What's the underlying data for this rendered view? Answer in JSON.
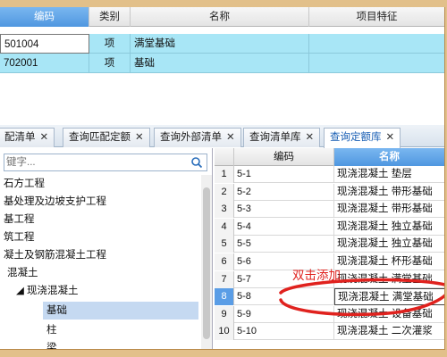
{
  "top_table": {
    "headers": {
      "code": "编码",
      "category": "类别",
      "name": "名称",
      "feature": "项目特征"
    },
    "rows": [
      {
        "code": "501004",
        "category": "项",
        "name": "满堂基础"
      },
      {
        "code": "702001",
        "category": "项",
        "name": "基础"
      }
    ]
  },
  "tabs": [
    {
      "label": "配清单",
      "close": "✕"
    },
    {
      "label": "查询匹配定额",
      "close": "✕"
    },
    {
      "label": "查询外部清单",
      "close": "✕"
    },
    {
      "label": "查询清单库",
      "close": "✕"
    },
    {
      "label": "查询定额库",
      "close": "✕"
    }
  ],
  "search": {
    "placeholder": "键字..."
  },
  "tree": [
    {
      "label": "石方工程"
    },
    {
      "label": "基处理及边坡支护工程"
    },
    {
      "label": "基工程"
    },
    {
      "label": "筑工程"
    },
    {
      "label": "凝土及钢筋混凝土工程"
    },
    {
      "label": "混凝土"
    },
    {
      "label": "◢  现浇混凝土"
    },
    {
      "label": "基础"
    },
    {
      "label": "柱"
    },
    {
      "label": "梁"
    }
  ],
  "right_table": {
    "headers": {
      "code": "编码",
      "name": "名称"
    },
    "rows": [
      {
        "num": "1",
        "code": "5-1",
        "name": "现浇混凝土 垫层"
      },
      {
        "num": "2",
        "code": "5-2",
        "name": "现浇混凝土 带形基础"
      },
      {
        "num": "3",
        "code": "5-3",
        "name": "现浇混凝土 带形基础"
      },
      {
        "num": "4",
        "code": "5-4",
        "name": "现浇混凝土 独立基础"
      },
      {
        "num": "5",
        "code": "5-5",
        "name": "现浇混凝土 独立基础"
      },
      {
        "num": "6",
        "code": "5-6",
        "name": "现浇混凝土 杯形基础"
      },
      {
        "num": "7",
        "code": "5-7",
        "name": "现浇混凝土 满堂基础"
      },
      {
        "num": "8",
        "code": "5-8",
        "name": "现浇混凝土 满堂基础"
      },
      {
        "num": "9",
        "code": "5-9",
        "name": "现浇混凝土 设备基础"
      },
      {
        "num": "10",
        "code": "5-10",
        "name": "现浇混凝土 二次灌浆"
      }
    ]
  },
  "annotation": {
    "text": "双击添加"
  },
  "colors": {
    "annotation": "#e0221e",
    "row_highlight": "#a8e6f6",
    "active_tab": "#1a5fb4"
  }
}
